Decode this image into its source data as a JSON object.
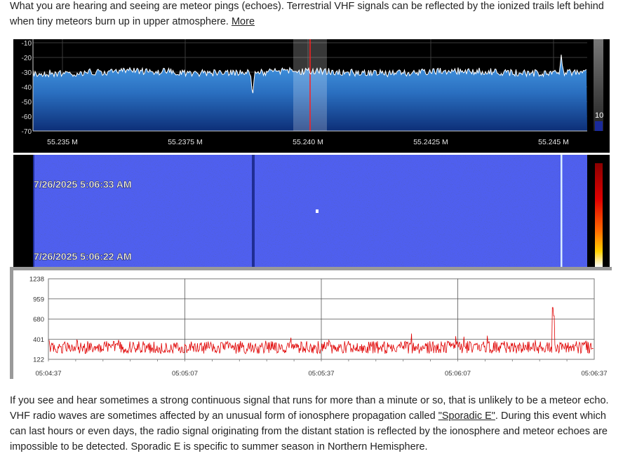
{
  "intro": {
    "text": "What you are hearing and seeing are meteor pings (echoes). Terrestrial VHF signals can be reflected by the ionized trails left behind when tiny meteors burn up in upper atmosphere.",
    "more_link": "More"
  },
  "spectrum": {
    "y_ticks": [
      "-10",
      "-20",
      "-30",
      "-40",
      "-50",
      "-60",
      "-70"
    ],
    "x_ticks": [
      "55.235 M",
      "55.2375 M",
      "55.240 M",
      "55.2425 M",
      "55.245 M"
    ],
    "gain_label": "10",
    "colors": {
      "fill": "#2f7fd0",
      "trace": "#ffffff",
      "tuner_line": "#ff2020"
    }
  },
  "waterfall": {
    "timestamps": [
      "7/26/2025 5:06:33 AM",
      "7/26/2025 5:06:22 AM"
    ],
    "colors": {
      "noise": "#1e2fa0",
      "palette_top": "#8b0000",
      "palette_bottom": "#ffffff"
    }
  },
  "timeplot": {
    "y_ticks": [
      "1238",
      "959",
      "680",
      "401",
      "122"
    ],
    "x_ticks": [
      "05:04:37",
      "05:05:07",
      "05:05:37",
      "05:06:07",
      "05:06:37"
    ],
    "colors": {
      "trace": "#e00000"
    }
  },
  "outro": {
    "text_before": "If you see and hear sometimes a strong continuous signal that runs for more than a minute or so, that is unlikely to be a meteor echo. VHF radio waves are sometimes affected by an unusual form of ionosphere propagation called ",
    "link": "\"Sporadic E\"",
    "text_after": ". During this event which can last hours or even days, the radio signal originating from the distant station is reflected by the ionosphere and meteor echoes are impossible to be detected. Sporadic E is specific to summer season in Northern Hemisphere."
  }
}
